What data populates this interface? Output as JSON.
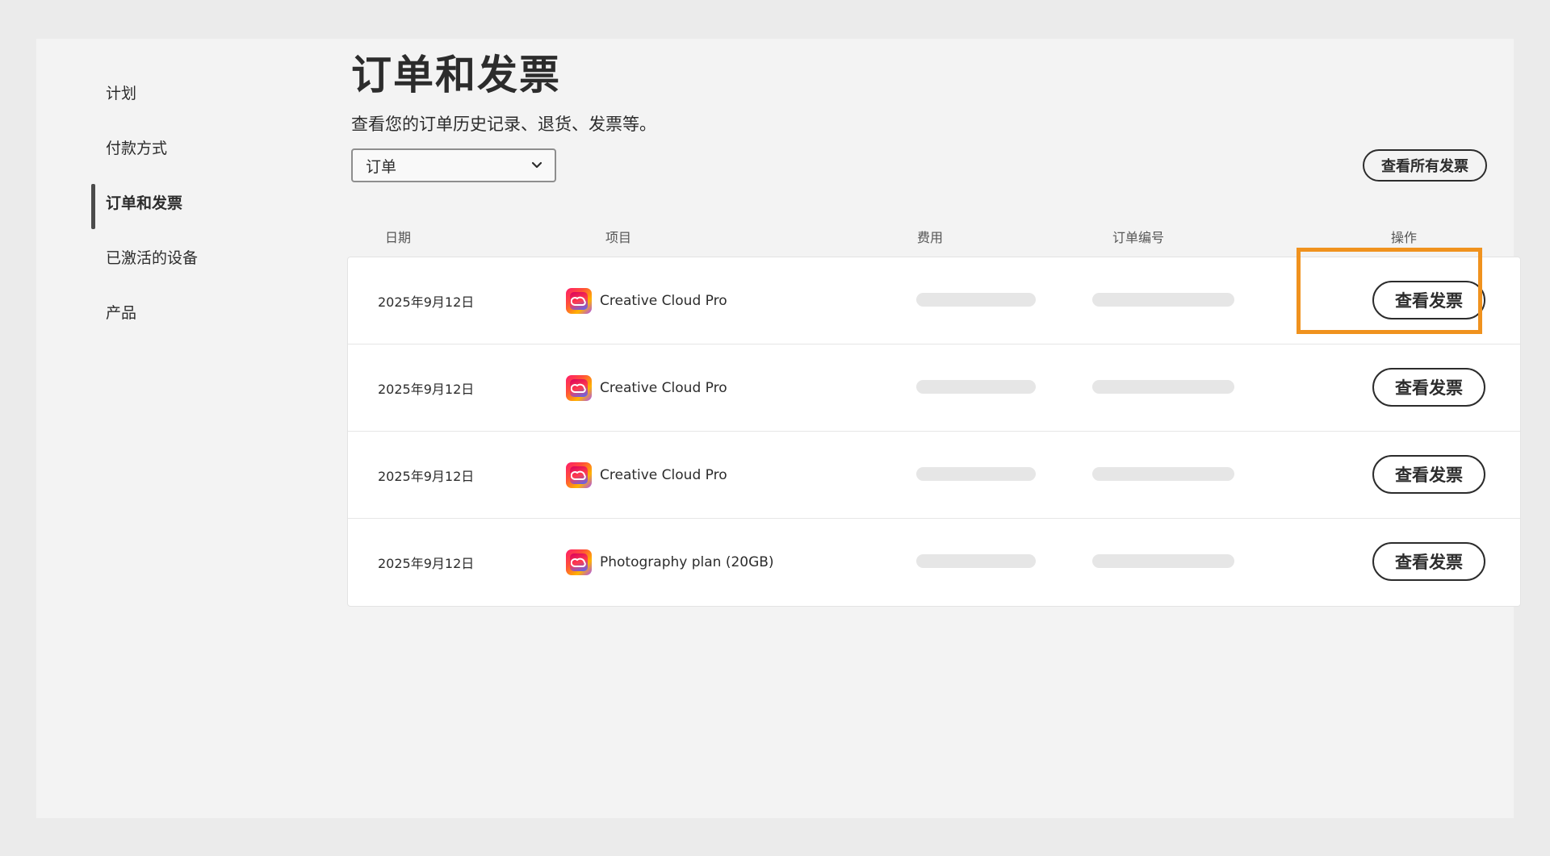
{
  "sidebar": {
    "items": [
      {
        "label": "计划",
        "active": false
      },
      {
        "label": "付款方式",
        "active": false
      },
      {
        "label": "订单和发票",
        "active": true
      },
      {
        "label": "已激活的设备",
        "active": false
      },
      {
        "label": "产品",
        "active": false
      }
    ]
  },
  "main": {
    "title": "订单和发票",
    "subtitle": "查看您的订单历史记录、退货、发票等。",
    "filter": {
      "selected": "订单",
      "icon": "chevron-down-icon"
    },
    "view_all_label": "查看所有发票",
    "table": {
      "headers": {
        "date": "日期",
        "item": "项目",
        "fee": "费用",
        "order_no": "订单编号",
        "action": "操作"
      },
      "rows": [
        {
          "date": "2025年9月12日",
          "item": "Creative Cloud Pro",
          "action": "查看发票"
        },
        {
          "date": "2025年9月12日",
          "item": "Creative Cloud Pro",
          "action": "查看发票"
        },
        {
          "date": "2025年9月12日",
          "item": "Creative Cloud Pro",
          "action": "查看发票"
        },
        {
          "date": "2025年9月12日",
          "item": "Photography plan (20GB)",
          "action": "查看发票"
        }
      ]
    }
  },
  "colors": {
    "highlight": "#f0921e",
    "background": "#f3f3f3",
    "outer": "#ebebeb",
    "text": "#2c2c2c"
  },
  "icons": {
    "app": "creative-cloud-icon"
  }
}
